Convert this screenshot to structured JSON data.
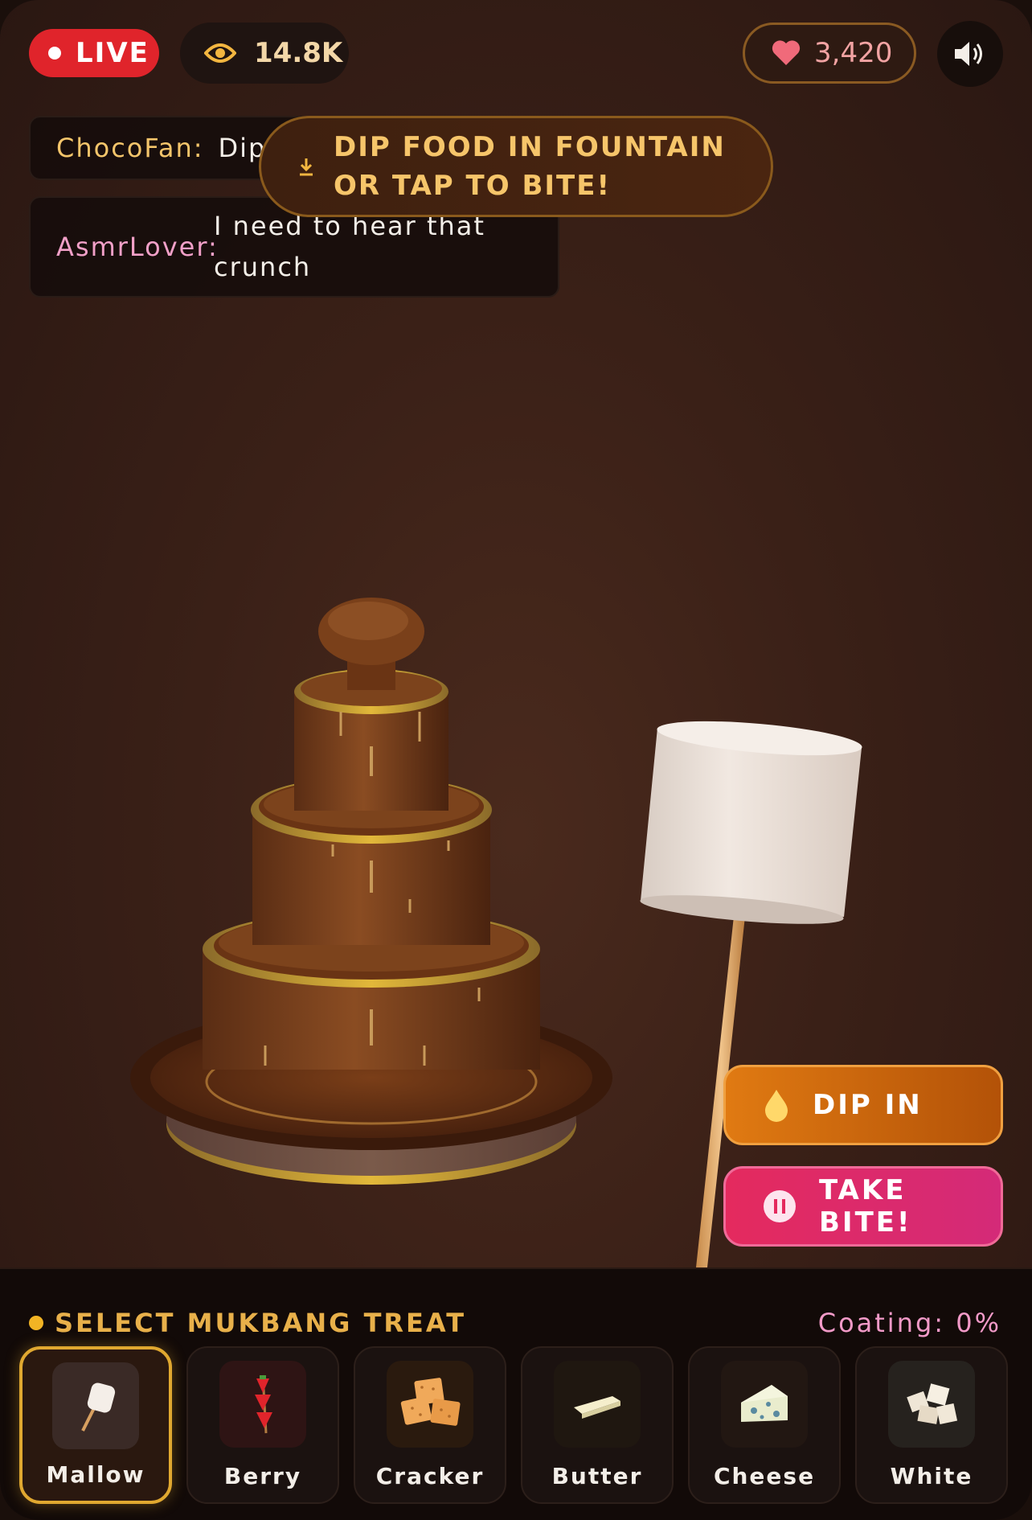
{
  "header": {
    "live_label": "LIVE",
    "viewer_count": "14.8K",
    "like_count": "3,420",
    "icons": [
      "eye-icon",
      "heart-icon",
      "speaker-icon"
    ]
  },
  "chat": {
    "messages": [
      {
        "user": "ChocoFan:",
        "text": "Dip i"
      },
      {
        "user": "AsmrLover:",
        "text": "I need to hear that crunch"
      }
    ]
  },
  "banner": {
    "icon": "download-arrow-icon",
    "text": "DIP FOOD IN FOUNTAIN OR TAP TO BITE!"
  },
  "actions": {
    "dip_label": "DIP IN",
    "bite_label": "TAKE BITE!"
  },
  "tray": {
    "title": "SELECT MUKBANG TREAT",
    "coating": "Coating: 0%",
    "selected": "Mallow",
    "items": [
      {
        "label": "Mallow",
        "icon": "marshmallow-icon"
      },
      {
        "label": "Berry",
        "icon": "strawberry-skewer-icon"
      },
      {
        "label": "Cracker",
        "icon": "crackers-icon"
      },
      {
        "label": "Butter",
        "icon": "butter-icon"
      },
      {
        "label": "Cheese",
        "icon": "cheese-icon"
      },
      {
        "label": "White",
        "icon": "white-chocolate-icon"
      }
    ]
  },
  "colors": {
    "accent_gold": "#e0a830",
    "live_red": "#e0242b",
    "dip_orange": "#e07a12",
    "bite_pink": "#e42a5e"
  }
}
